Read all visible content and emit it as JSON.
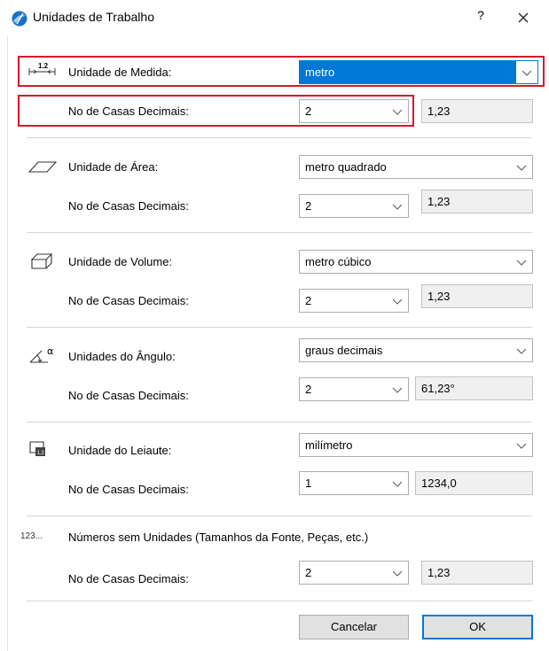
{
  "window": {
    "title": "Unidades de Trabalho",
    "help_label": "?",
    "app_icon": "archicad-logo-icon",
    "close_icon": "close-icon"
  },
  "sections": {
    "length": {
      "icon": "length-icon",
      "label": "Unidade de Medida:",
      "unit": "metro",
      "decimals_label": "No de Casas Decimais:",
      "decimals": "2",
      "preview": "1,23"
    },
    "area": {
      "icon": "area-icon",
      "label": "Unidade de Área:",
      "unit": "metro quadrado",
      "decimals_label": "No de Casas Decimais:",
      "decimals": "2",
      "preview": "1,23"
    },
    "volume": {
      "icon": "volume-icon",
      "label": "Unidade de Volume:",
      "unit": "metro cúbico",
      "decimals_label": "No de Casas Decimais:",
      "decimals": "2",
      "preview": "1,23"
    },
    "angle": {
      "icon": "angle-icon",
      "label": "Unidades do Ângulo:",
      "unit": "graus decimais",
      "decimals_label": "No de Casas Decimais:",
      "decimals": "2",
      "preview": "61,23°"
    },
    "layout": {
      "icon": "layout-icon",
      "label": "Unidade do Leiaute:",
      "unit": "milímetro",
      "decimals_label": "No de Casas Decimais:",
      "decimals": "1",
      "preview": "1234,0"
    },
    "unitless": {
      "icon_text": "123...",
      "label": "Números sem Unidades (Tamanhos da Fonte, Peças, etc.)",
      "decimals_label": "No de Casas Decimais:",
      "decimals": "2",
      "preview": "1,23"
    }
  },
  "buttons": {
    "cancel": "Cancelar",
    "ok": "OK"
  },
  "colors": {
    "highlight": "#d11b2a",
    "selection": "#0078d7"
  }
}
